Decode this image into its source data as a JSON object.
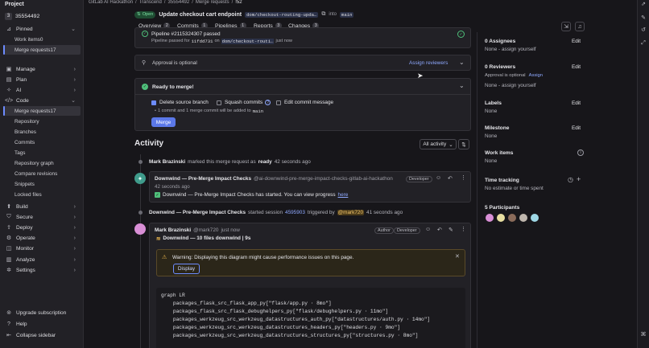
{
  "colors": {
    "accent": "#6d8cff",
    "success": "#4fbf7a",
    "warning": "#e9b44c",
    "bg": "#17161a"
  },
  "sidebar": {
    "title": "Project",
    "project_initial": "3",
    "project_name": "35554492",
    "pinned_label": "Pinned",
    "pinned_items": [
      {
        "label": "Work items",
        "count": "0"
      },
      {
        "label": "Merge requests",
        "count": "17"
      }
    ],
    "groups": [
      {
        "label": "Manage",
        "icon": "manage-icon"
      },
      {
        "label": "Plan",
        "icon": "plan-icon"
      },
      {
        "label": "AI",
        "icon": "ai-icon"
      },
      {
        "label": "Code",
        "icon": "code-icon"
      }
    ],
    "code_items": [
      {
        "label": "Merge requests",
        "count": "17"
      },
      {
        "label": "Repository"
      },
      {
        "label": "Branches"
      },
      {
        "label": "Commits"
      },
      {
        "label": "Tags"
      },
      {
        "label": "Repository graph"
      },
      {
        "label": "Compare revisions"
      },
      {
        "label": "Snippets"
      },
      {
        "label": "Locked files"
      }
    ],
    "more_groups": [
      {
        "label": "Build",
        "icon": "rocket-icon"
      },
      {
        "label": "Secure",
        "icon": "shield-icon"
      },
      {
        "label": "Deploy",
        "icon": "deploy-icon"
      },
      {
        "label": "Operate",
        "icon": "operate-icon"
      },
      {
        "label": "Monitor",
        "icon": "monitor-icon"
      },
      {
        "label": "Analyze",
        "icon": "chart-icon"
      },
      {
        "label": "Settings",
        "icon": "gear-icon"
      }
    ],
    "bottom": [
      {
        "label": "Upgrade subscription",
        "icon": "upgrade-icon"
      },
      {
        "label": "Help",
        "icon": "help-icon"
      },
      {
        "label": "Collapse sidebar",
        "icon": "collapse-icon"
      }
    ]
  },
  "breadcrumb": [
    "GitLab AI Hackathon",
    "Transcend",
    "35554492",
    "Merge requests",
    "!52"
  ],
  "mr": {
    "status": "Open",
    "title": "Update checkout cart endpoint",
    "source_branch": "dom/checkout-routing-upda…",
    "into_label": "into",
    "target_branch": "main"
  },
  "tabs": [
    {
      "label": "Overview",
      "count": "2"
    },
    {
      "label": "Commits",
      "count": "1"
    },
    {
      "label": "Pipelines",
      "count": "1"
    },
    {
      "label": "Reports",
      "count": "3"
    },
    {
      "label": "Changes",
      "count": "3"
    }
  ],
  "pipeline": {
    "text": "Pipeline #2115324307 passed",
    "detail_prefix": "Pipeline passed for",
    "commit": "11fdd731",
    "on_label": "on",
    "branch": "dom/checkout-routi…",
    "time": "just now"
  },
  "approval": {
    "text": "Approval is optional",
    "assign_label": "Assign reviewers"
  },
  "merge": {
    "title": "Ready to merge!",
    "delete_branch": "Delete source branch",
    "squash": "Squash commits",
    "edit_message": "Edit commit message",
    "note_prefix": "1 commit and 1 merge commit will be added to",
    "note_branch": "main",
    "button": "Merge"
  },
  "activity": {
    "heading": "Activity",
    "filter": "All activity",
    "event1": {
      "user": "Mark Brazinski",
      "text": "marked this merge request as",
      "bold": "ready",
      "time": "42 seconds ago"
    },
    "comment1": {
      "author": "Downwind — Pre-Merge Impact Checks",
      "handle": "@ai-downwind-pre-merge-impact-checks-gitlab-ai-hackathon",
      "role": "Developer",
      "time": "42 seconds ago",
      "body": "Downwind — Pre-Merge Impact Checks has started. You can view progress",
      "link": "here"
    },
    "event2": {
      "author": "Downwind — Pre-Merge Impact Checks",
      "text": "started session",
      "session": "4595903",
      "triggered": "triggered by",
      "mention": "@mark720",
      "time": "41 seconds ago"
    },
    "comment2": {
      "author": "Mark Brazinski",
      "handle": "@mark720",
      "time": "just now",
      "role1": "Author",
      "role2": "Developer",
      "summary": "Downwind — 10 files downwind | 9s",
      "warning": "Warning: Displaying this diagram might cause performance issues on this page.",
      "display_label": "Display"
    },
    "code_lines": [
      "graph LR",
      "    packages_flask_src_flask_app_py[\"flask/app.py · 8mo\"]",
      "    packages_flask_src_flask_debughelpers_py[\"flask/debughelpers.py · 11mo\"]",
      "    packages_werkzeug_src_werkzeug_datastructures_auth_py[\"datastructures/auth.py · 14mo\"]",
      "    packages_werkzeug_src_werkzeug_datastructures_headers_py[\"headers.py · 9mo\"]",
      "    packages_werkzeug_src_werkzeug_datastructures_structures_py[\"structures.py · 8mo\"]"
    ]
  },
  "right_panel": {
    "assignees": {
      "label": "0 Assignees",
      "edit": "Edit",
      "value": "None - assign yourself"
    },
    "reviewers": {
      "label": "0 Reviewers",
      "edit": "Edit",
      "note": "Approval is optional",
      "assign": "Assign",
      "value": "None - assign yourself"
    },
    "labels": {
      "label": "Labels",
      "edit": "Edit",
      "value": "None"
    },
    "milestone": {
      "label": "Milestone",
      "edit": "Edit",
      "value": "None"
    },
    "work_items": {
      "label": "Work items",
      "value": "None"
    },
    "time_tracking": {
      "label": "Time tracking",
      "value": "No estimate or time spent"
    },
    "participants": {
      "label": "5 Participants"
    }
  }
}
